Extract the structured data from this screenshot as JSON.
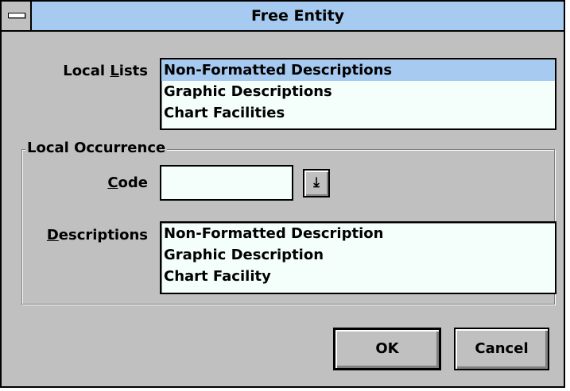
{
  "window": {
    "title": "Free Entity"
  },
  "local_lists": {
    "label_prefix": "Local ",
    "label_mnemonic": "L",
    "label_suffix": "ists",
    "items": [
      "Non-Formatted Descriptions",
      "Graphic Descriptions",
      "Chart Facilities"
    ],
    "selected_index": 0
  },
  "local_occurrence": {
    "group_title": "Local Occurrence",
    "code": {
      "label_mnemonic": "C",
      "label_suffix": "ode",
      "value": "",
      "dropdown_glyph": "⤓"
    },
    "descriptions": {
      "label_mnemonic": "D",
      "label_suffix": "escriptions",
      "items": [
        "Non-Formatted Description",
        "Graphic Description",
        "Chart Facility"
      ]
    }
  },
  "buttons": {
    "ok_label": "OK",
    "cancel_label": "Cancel"
  },
  "colors": {
    "titlebar": "#a6caf0",
    "selection": "#a6caf0",
    "face": "#c0c0c0",
    "field": "#f4fffb"
  }
}
